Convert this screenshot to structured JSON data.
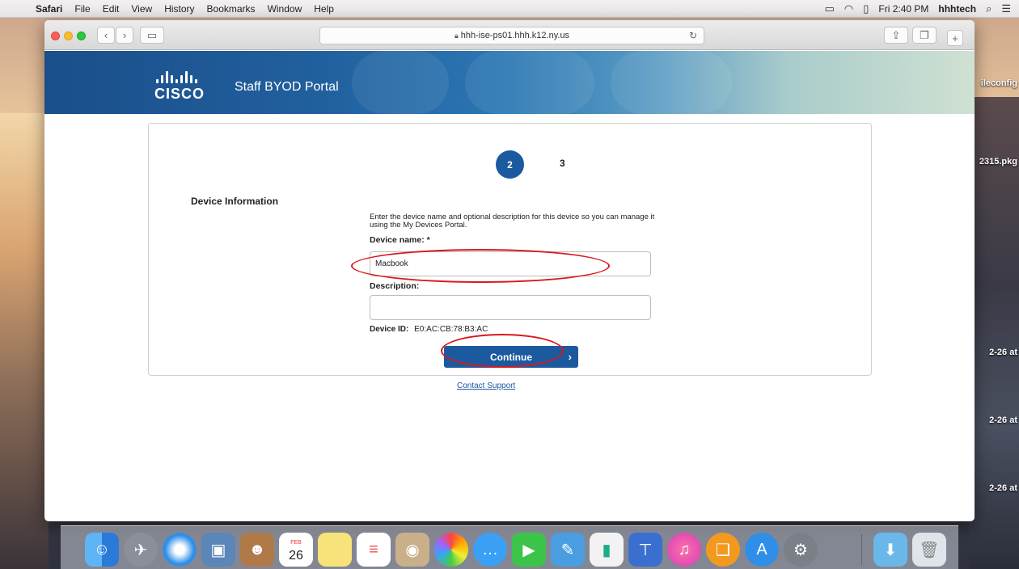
{
  "menubar": {
    "app": "Safari",
    "items": [
      "File",
      "Edit",
      "View",
      "History",
      "Bookmarks",
      "Window",
      "Help"
    ],
    "clock": "Fri 2:40 PM",
    "user": "hhhtech"
  },
  "browser": {
    "url": "hhh-ise-ps01.hhh.k12.ny.us"
  },
  "portal": {
    "logo_text": "CISCO",
    "title": "Staff BYOD Portal",
    "step_current": "2",
    "step_next": "3",
    "section_title": "Device Information",
    "instructions": "Enter the device name and optional description for this device so you can manage it using the My Devices Portal.",
    "device_name_label": "Device name: *",
    "device_name_value": "Macbook",
    "description_label": "Description:",
    "description_value": "",
    "device_id_label": "Device ID:",
    "device_id_value": "E0:AC:CB:78:B3:AC",
    "continue_label": "Continue",
    "contact_support": "Contact Support"
  },
  "desktop_labels": [
    "ileconfig",
    "2315.pkg",
    "2-26 at",
    "2-26 at",
    "2-26 at"
  ],
  "dock": {
    "calendar_month": "FEB",
    "calendar_day": "26",
    "icons": [
      "finder-icon",
      "launchpad-icon",
      "safari-icon",
      "preview-icon",
      "contacts-icon",
      "calendar-icon",
      "notes-icon",
      "reminders-icon",
      "photo-booth-icon",
      "photos-icon",
      "messages-icon",
      "facetime-icon",
      "textedit-icon",
      "numbers-icon",
      "keynote-icon",
      "itunes-icon",
      "ibooks-icon",
      "app-store-icon",
      "system-preferences-icon",
      "downloads-folder-icon",
      "trash-icon"
    ]
  }
}
